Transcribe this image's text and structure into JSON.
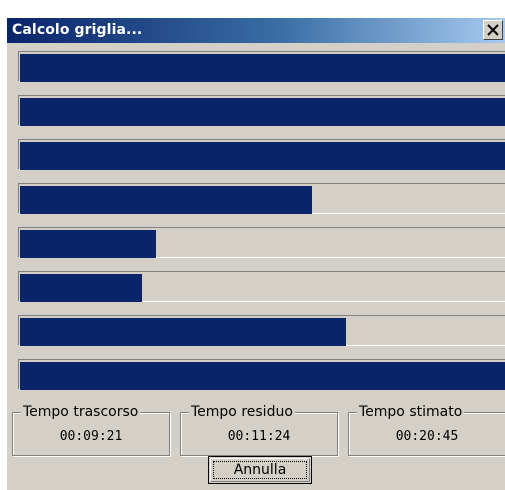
{
  "window": {
    "title": "Calcolo griglia...",
    "close_icon": "close-icon"
  },
  "progress_bars": [
    {
      "percent": 100
    },
    {
      "percent": 100
    },
    {
      "percent": 100
    },
    {
      "percent": 60
    },
    {
      "percent": 28
    },
    {
      "percent": 25
    },
    {
      "percent": 67
    },
    {
      "percent": 100
    }
  ],
  "colors": {
    "progress_fill": "#0a246a",
    "dialog_background": "#d4d0c8"
  },
  "timers": {
    "elapsed": {
      "label": "Tempo trascorso",
      "value": "00:09:21"
    },
    "remaining": {
      "label": "Tempo residuo",
      "value": "00:11:24"
    },
    "estimated": {
      "label": "Tempo stimato",
      "value": "00:20:45"
    }
  },
  "buttons": {
    "cancel_label": "Annulla"
  }
}
